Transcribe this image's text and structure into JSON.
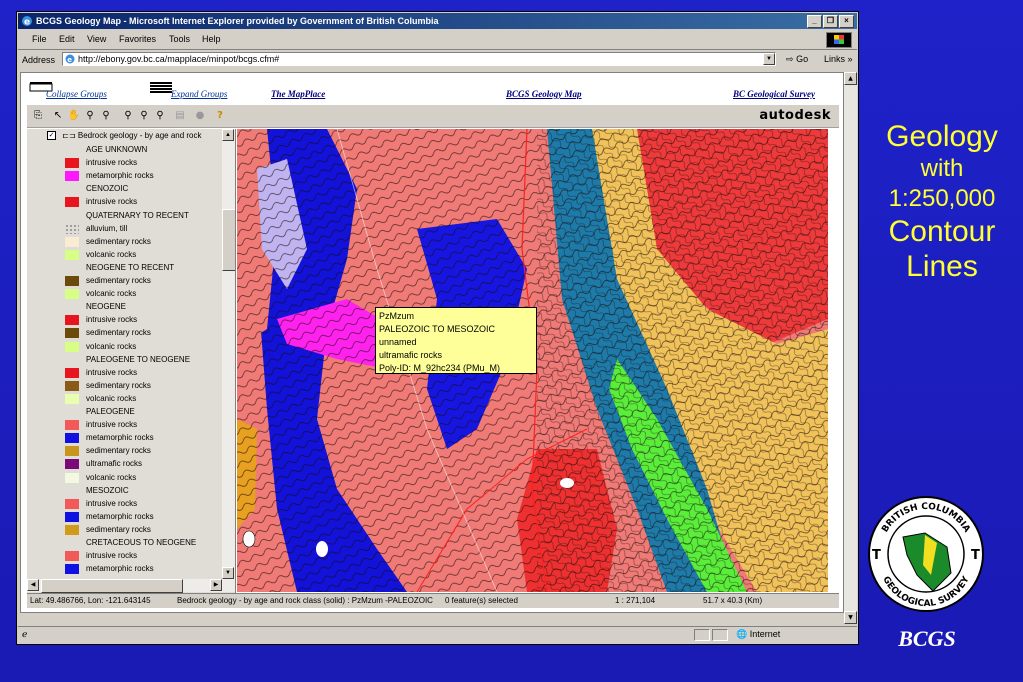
{
  "window": {
    "title": "BCGS Geology Map - Microsoft Internet Explorer provided by Government of British Columbia",
    "controls": [
      "_",
      "❐",
      "×"
    ]
  },
  "menu": [
    "File",
    "Edit",
    "View",
    "Favorites",
    "Tools",
    "Help"
  ],
  "address": {
    "label": "Address",
    "url": "http://ebony.gov.bc.ca/mapplace/minpot/bcgs.cfm#",
    "go_label": "Go",
    "links_label": "Links »"
  },
  "nav": {
    "collapse": "Collapse Groups",
    "expand": "Expand Groups",
    "mapplace": "The MapPlace",
    "bcgs_map": "BCGS Geology Map",
    "survey": "BC Geological Survey"
  },
  "toolbar": {
    "brand": "autodesk",
    "tools": [
      "copy",
      "pointer",
      "pan",
      "zoom-in",
      "zoom-out",
      "zoom-prev",
      "zoom-goto",
      "zoom-width",
      "print",
      "stop",
      "help"
    ]
  },
  "legend": {
    "layer_title": "Bedrock geology - by age and rock",
    "rows": [
      {
        "type": "header",
        "label": "AGE UNKNOWN"
      },
      {
        "type": "item",
        "label": "intrusive rocks",
        "color": "#e8141e"
      },
      {
        "type": "item",
        "label": "metamorphic rocks",
        "color": "#ff17ff"
      },
      {
        "type": "header",
        "label": "CENOZOIC"
      },
      {
        "type": "item",
        "label": "intrusive rocks",
        "color": "#e8141e"
      },
      {
        "type": "header",
        "label": "QUATERNARY TO RECENT"
      },
      {
        "type": "item",
        "label": "alluvium, till",
        "color": "dotted"
      },
      {
        "type": "item",
        "label": "sedimentary rocks",
        "color": "#f9ecd2"
      },
      {
        "type": "item",
        "label": "volcanic rocks",
        "color": "#d7ff85"
      },
      {
        "type": "header",
        "label": "NEOGENE TO RECENT"
      },
      {
        "type": "item",
        "label": "sedimentary rocks",
        "color": "#6b4a0a"
      },
      {
        "type": "item",
        "label": "volcanic rocks",
        "color": "#d7ff85"
      },
      {
        "type": "header",
        "label": "NEOGENE"
      },
      {
        "type": "item",
        "label": "intrusive rocks",
        "color": "#e8141e"
      },
      {
        "type": "item",
        "label": "sedimentary rocks",
        "color": "#6b4a0a"
      },
      {
        "type": "item",
        "label": "volcanic rocks",
        "color": "#d7ff85"
      },
      {
        "type": "header",
        "label": "PALEOGENE TO NEOGENE"
      },
      {
        "type": "item",
        "label": "intrusive rocks",
        "color": "#e8141e"
      },
      {
        "type": "item",
        "label": "sedimentary rocks",
        "color": "#8b5a16"
      },
      {
        "type": "item",
        "label": "volcanic rocks",
        "color": "#e8ffb0"
      },
      {
        "type": "header",
        "label": "PALEOGENE"
      },
      {
        "type": "item",
        "label": "intrusive rocks",
        "color": "#f25a5a"
      },
      {
        "type": "item",
        "label": "metamorphic rocks",
        "color": "#1010e0"
      },
      {
        "type": "item",
        "label": "sedimentary rocks",
        "color": "#c8961e"
      },
      {
        "type": "item",
        "label": "ultramafic rocks",
        "color": "#7a0a7a"
      },
      {
        "type": "item",
        "label": "volcanic rocks",
        "color": "#f4f8e0"
      },
      {
        "type": "header",
        "label": "MESOZOIC"
      },
      {
        "type": "item",
        "label": "intrusive rocks",
        "color": "#f25a5a"
      },
      {
        "type": "item",
        "label": "metamorphic rocks",
        "color": "#1010e0"
      },
      {
        "type": "item",
        "label": "sedimentary rocks",
        "color": "#d09a1a"
      },
      {
        "type": "header",
        "label": "CRETACEOUS TO NEOGENE"
      },
      {
        "type": "item",
        "label": "intrusive rocks",
        "color": "#f25a5a"
      },
      {
        "type": "item",
        "label": "metamorphic rocks",
        "color": "#1010e0"
      }
    ]
  },
  "tooltip": {
    "lines": [
      "PzMzum",
      "PALEOZOIC TO MESOZOIC",
      "unnamed",
      "ultramafic rocks",
      "Poly-ID: M_92hc234  (PMu_M)"
    ]
  },
  "map_status": {
    "coords": "Lat: 49.486766, Lon: -121.643145",
    "layer": "Bedrock geology - by age and rock class (solid) : PzMzum -PALEOZOIC",
    "selected": "0 feature(s) selected",
    "scale": "1 : 271,104",
    "extent": "51.7 x 40.3 (Km)"
  },
  "statusbar": {
    "zone": "Internet"
  },
  "slide": {
    "title_lines": [
      "Geology",
      "with",
      "1:250,000",
      "Contour",
      "Lines"
    ],
    "seal_top": "BRITISH COLUMBIA",
    "seal_bottom": "GEOLOGICAL SURVEY",
    "footer": "BCGS"
  },
  "colors": {
    "slide_bg": "#1c1cb8",
    "title_yellow": "#ffff33",
    "tooltip_bg": "#ffff99",
    "link": "#003399"
  }
}
